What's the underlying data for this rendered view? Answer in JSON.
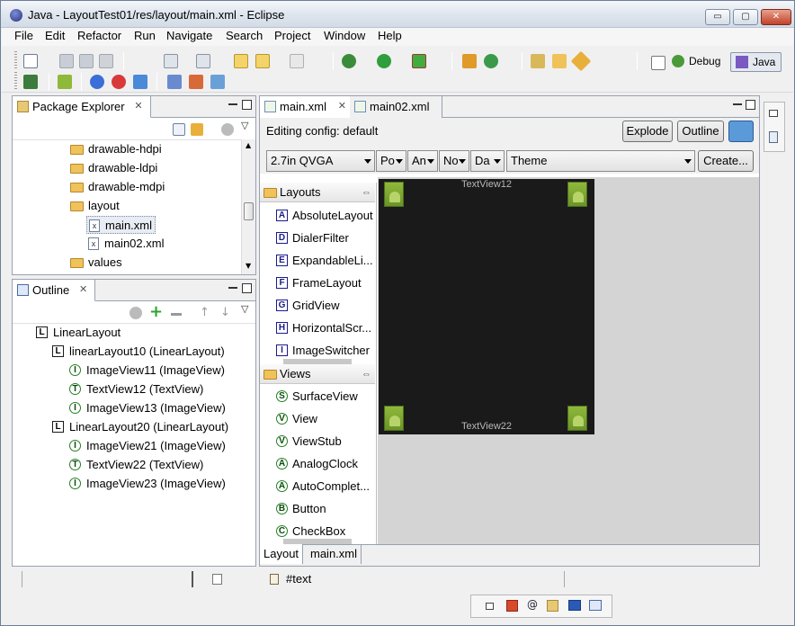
{
  "window": {
    "title": "Java - LayoutTest01/res/layout/main.xml - Eclipse"
  },
  "window_controls": {
    "minimize": "▭",
    "maximize": "▢",
    "close": "✕"
  },
  "menu": [
    "File",
    "Edit",
    "Refactor",
    "Run",
    "Navigate",
    "Search",
    "Project",
    "Window",
    "Help"
  ],
  "perspectives": {
    "debug": "Debug",
    "java": "Java"
  },
  "package_explorer": {
    "title": "Package Explorer",
    "items": [
      {
        "label": "drawable-hdpi",
        "type": "folder"
      },
      {
        "label": "drawable-ldpi",
        "type": "folder"
      },
      {
        "label": "drawable-mdpi",
        "type": "folder"
      },
      {
        "label": "layout",
        "type": "folder"
      },
      {
        "label": "main.xml",
        "type": "xml",
        "selected": true
      },
      {
        "label": "main02.xml",
        "type": "xml"
      },
      {
        "label": "values",
        "type": "folder"
      }
    ]
  },
  "outline": {
    "title": "Outline",
    "items": [
      {
        "label": "LinearLayout",
        "icon": "L"
      },
      {
        "label": "linearLayout10 (LinearLayout)",
        "icon": "L"
      },
      {
        "label": "ImageView11 (ImageView)",
        "icon": "I"
      },
      {
        "label": "TextView12 (TextView)",
        "icon": "T"
      },
      {
        "label": "ImageView13 (ImageView)",
        "icon": "I"
      },
      {
        "label": "LinearLayout20 (LinearLayout)",
        "icon": "L"
      },
      {
        "label": "ImageView21 (ImageView)",
        "icon": "I"
      },
      {
        "label": "TextView22 (TextView)",
        "icon": "T"
      },
      {
        "label": "ImageView23 (ImageView)",
        "icon": "I"
      }
    ]
  },
  "editor": {
    "tabs": [
      {
        "label": "main.xml",
        "active": true,
        "close": "✕"
      },
      {
        "label": "main02.xml",
        "active": false
      }
    ],
    "config_label": "Editing config: default",
    "buttons": {
      "explode": "Explode",
      "outline": "Outline",
      "create": "Create..."
    },
    "combos": {
      "device": "2.7in QVGA",
      "orientation": "Po",
      "dock": "An",
      "night": "No",
      "density": "Da",
      "theme": "Theme"
    },
    "palette": {
      "layouts_header": "Layouts",
      "layouts": [
        {
          "label": "AbsoluteLayout",
          "icon": "A"
        },
        {
          "label": "DialerFilter",
          "icon": "D"
        },
        {
          "label": "ExpandableLi...",
          "icon": "E"
        },
        {
          "label": "FrameLayout",
          "icon": "F"
        },
        {
          "label": "GridView",
          "icon": "G"
        },
        {
          "label": "HorizontalScr...",
          "icon": "H"
        },
        {
          "label": "ImageSwitcher",
          "icon": "I"
        }
      ],
      "views_header": "Views",
      "views": [
        {
          "label": "SurfaceView",
          "icon": "S"
        },
        {
          "label": "View",
          "icon": "V"
        },
        {
          "label": "ViewStub",
          "icon": "V"
        },
        {
          "label": "AnalogClock",
          "icon": "A"
        },
        {
          "label": "AutoComplet...",
          "icon": "A"
        },
        {
          "label": "Button",
          "icon": "B"
        },
        {
          "label": "CheckBox",
          "icon": "C"
        }
      ]
    },
    "canvas": {
      "top_text": "TextView12",
      "bottom_text": "TextView22"
    },
    "bottom_tabs": [
      "Layout",
      "main.xml"
    ]
  },
  "status": {
    "text": "#text"
  },
  "colors": {
    "canvas_bg": "#1a1a1a",
    "editor_bg": "#d4d4d4",
    "accent": "#98a2ae"
  }
}
